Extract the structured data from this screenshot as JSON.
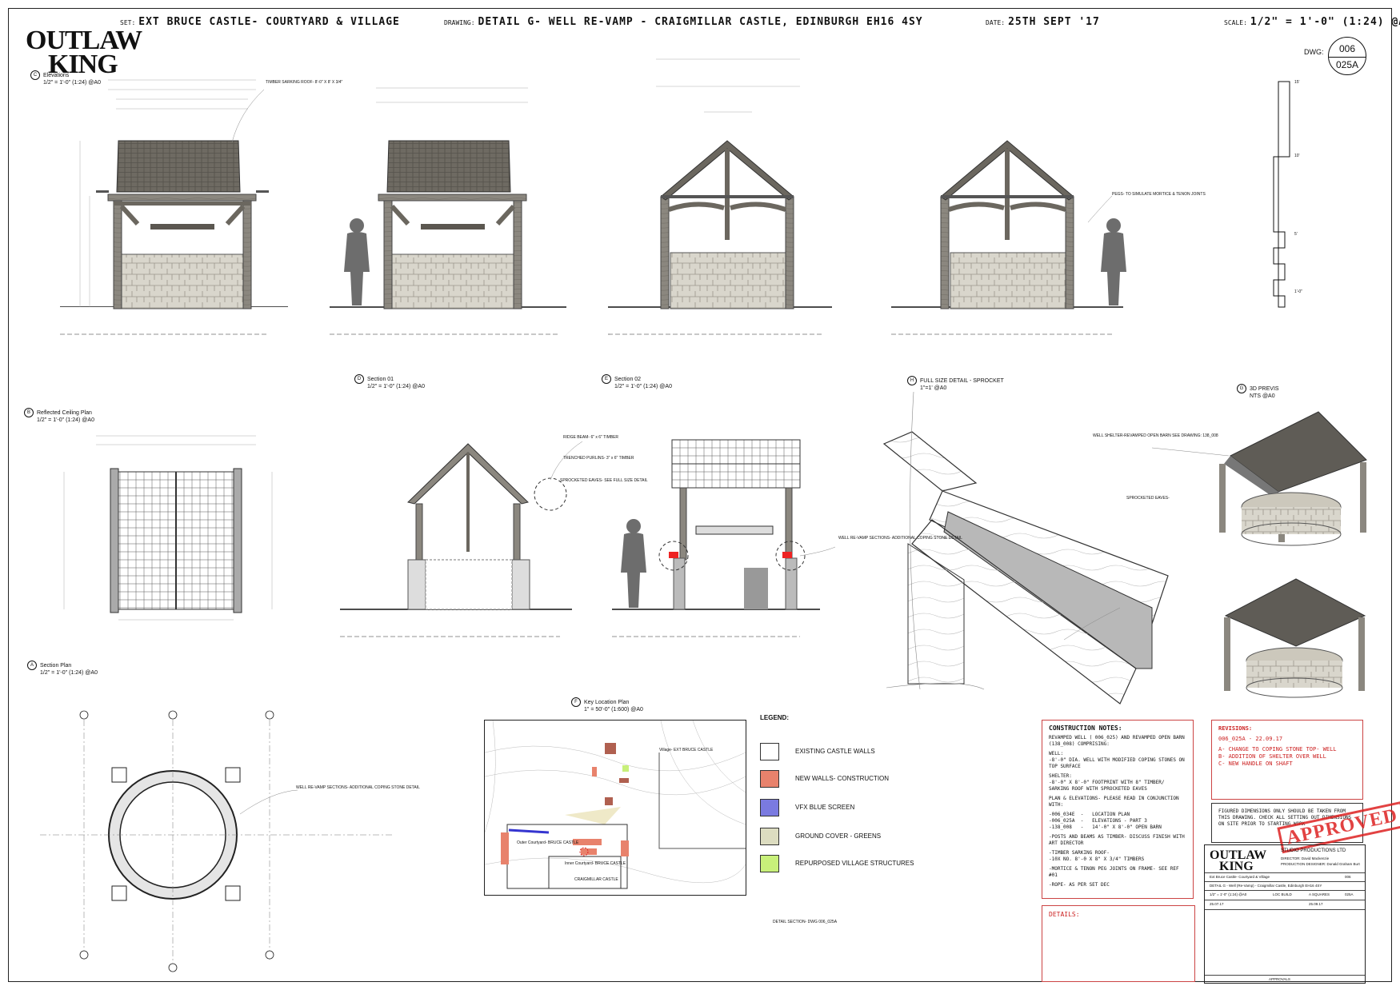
{
  "header": {
    "set_key": "SET:",
    "set_value": "EXT BRUCE CASTLE- COURTYARD & VILLAGE",
    "drawing_key": "DRAWING:",
    "drawing_value": "DETAIL G- WELL RE-VAMP  - CRAIGMILLAR CASTLE, EDINBURGH  EH16 4SY",
    "date_key": "DATE:",
    "date_value": "25TH SEPT '17",
    "scale_key": "SCALE:",
    "scale_value": "1/2\" = 1'-0\" (1:24) @A0"
  },
  "sheet": {
    "number": "006",
    "sub": "025A",
    "dwg_label": "DWG:"
  },
  "logo": {
    "line1": "OUTLAW",
    "line2": "KING"
  },
  "views": {
    "elevations": {
      "bubble": "C",
      "title": "Elevations",
      "scale": "1/2\" = 1'-0\" (1:24) @A0"
    },
    "rcp": {
      "bubble": "B",
      "title": "Reflected Ceiling Plan",
      "scale": "1/2\" = 1'-0\" (1:24) @A0"
    },
    "section_plan": {
      "bubble": "A",
      "title": "Section Plan",
      "scale": "1/2\" = 1'-0\" (1:24) @A0"
    },
    "section01": {
      "bubble": "D",
      "title": "Section 01",
      "scale": "1/2\" = 1'-0\" (1:24) @A0"
    },
    "section02": {
      "bubble": "E",
      "title": "Section 02",
      "scale": "1/2\" = 1'-0\" (1:24) @A0"
    },
    "sprocket": {
      "bubble": "H",
      "title": "FULL SIZE DETAIL - SPROCKET",
      "scale": "1\"=1' @A0"
    },
    "previs": {
      "bubble": "G",
      "title": "3D PREVIS",
      "scale": "NTS @A0"
    },
    "key_plan": {
      "bubble": "F",
      "title": "Key Location Plan",
      "scale": "1\" = 50'-0\" (1:600) @A0"
    }
  },
  "annotations": {
    "sarking_roof": "TIMBER SARKING ROOF- 8'-0\" X 8' X 3/4\"",
    "pegs": "PEGS- TO SIMULATE MORTICE & TENON JOINTS",
    "ridge_beam": "RIDGE BEAM- 6\" x 6\" TIMBER",
    "purlins": "TRENCHED PURLINS- 3\" x 6\" TIMBER",
    "sprocketed_eaves": "SPROCKETED EAVES- SEE FULL SIZE DETAIL",
    "well_sections": "WELL RE-VAMP SECTIONS- ADDITIONAL COPING STONE DETAIL",
    "well_sections_plan": "WELL RE-VAMP SECTIONS- ADDITIONAL COPING STONE DETAIL",
    "open_barn": "WELL SHELTER-REVAMPED OPEN BARN SEE DRAWING: 138_008",
    "sprocketed_eaves_detail": "SPROCKETED EAVES-",
    "detail_section": "DETAIL SECTION- DWG 006_025A"
  },
  "height_marks": [
    "15'",
    "10'",
    "5'",
    "1'-0\""
  ],
  "legend": {
    "title": "LEGEND:",
    "items": [
      {
        "label": "EXISTING CASTLE WALLS",
        "color": "#ffffff"
      },
      {
        "label": "NEW WALLS- CONSTRUCTION",
        "color": "#e8826c"
      },
      {
        "label": "VFX BLUE SCREEN",
        "color": "#7a7ae0"
      },
      {
        "label": "GROUND COVER - GREENS",
        "color": "#dcdcc0"
      },
      {
        "label": "REPURPOSED VILLAGE STRUCTURES",
        "color": "#c8f07a"
      }
    ]
  },
  "construction_notes": {
    "title": "CONSTRUCTION NOTES:",
    "paras": [
      "REVAMPED WELL ( 006_025) AND REVAMPED OPEN BARN (138_008) COMPRISING:",
      "WELL:\n-8'-0\" DIA. WELL WITH MODIFIED COPING STONES ON TOP SURFACE",
      "SHELTER:\n-8'-0\" X 8'-0\" FOOTPRINT WITH 8\" TIMBER/ SARKING ROOF WITH SPROCKETED EAVES",
      "PLAN & ELEVATIONS- PLEASE READ IN CONJUNCTION WITH:",
      "-006_034E  -   LOCATION PLAN\n-006_025A  -   ELEVATIONS - PART 3\n-138_008   -   14'-0\" X 8'-0\" OPEN BARN",
      "-POSTS AND BEAMS AS TIMBER- DISCUSS FINISH WITH ART DIRECTOR",
      "-TIMBER SARKING ROOF-\n-10X NO. 8'-0 X 8\" X 3/4\" TIMBERS",
      "-MORTICE & TENON PEG JOINTS ON FRAME- SEE REF #01",
      "-ROPE- AS PER SET DEC"
    ]
  },
  "details_label": "DETAILS:",
  "revisions": {
    "title": "REVISIONS:",
    "lines": [
      "006_025A - 22.09.17",
      "A- CHANGE TO COPING STONE TOP- WELL",
      "B- ADDITION OF SHELTER OVER WELL",
      "C- NEW HANDLE ON SHAFT"
    ]
  },
  "figured_note": "FIGURED DIMENSIONS ONLY SHOULD BE TAKEN FROM THIS DRAWING. CHECK ALL SETTING OUT DIMENSIONS ON SITE PRIOR TO STARTING WORK",
  "stamp": "APPROVED",
  "title_block": {
    "company": "STUDIO PRODUCTIONS LTD",
    "director": "DIRECTOR: David Mackenzie",
    "designer": "PRODUCTION DESIGNER: Donald Graham Burt",
    "set": "Ext Bruce Castle- Courtyard & Village",
    "detail": "DETAIL G - Well (Re-Vamp) - Craigmillar Castle, Edinburgh EH16 4SY",
    "scale": "1/2\" = 1'-0\" (1:24) @A0",
    "set_no": "006",
    "drawing_no": "025A",
    "date_drawn": "25.07.17",
    "date_rev": "25.09.17",
    "build": "LOC BUILD",
    "issue": "A SQUARES",
    "approvals": "APPROVALS"
  },
  "map_labels": {
    "village": "Village- EXT BRUCE CASTLE",
    "courtyard": "Outer Courtyard- BRUCE CASTLE",
    "inner": "Inner Courtyard- BRUCE CASTLE",
    "craigmillar": "CRAIGMILLAR CASTLE"
  }
}
